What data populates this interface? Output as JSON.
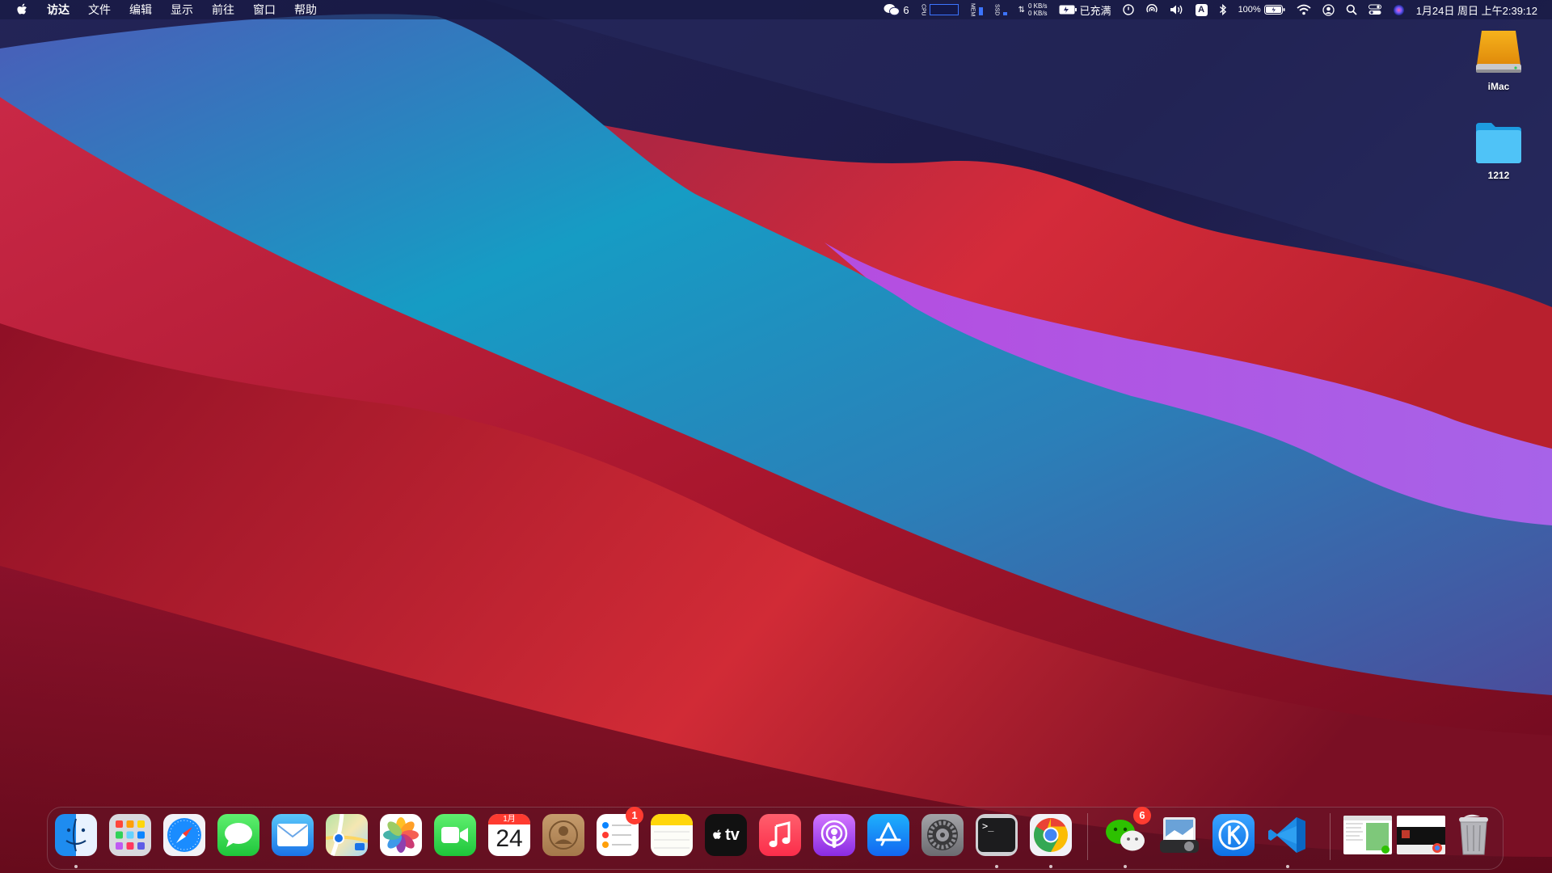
{
  "menubar": {
    "menus": [
      "访达",
      "文件",
      "编辑",
      "显示",
      "前往",
      "窗口",
      "帮助"
    ],
    "status": {
      "wechat_count": "6",
      "net_up": "0 KB/s",
      "net_down": "0 KB/s",
      "battery_state": "已充满",
      "input_source": "A",
      "battery_percent": "100%",
      "datetime": "1月24日 周日 上午2:39:12"
    }
  },
  "desktop": {
    "icons": [
      {
        "label": "iMac",
        "icon": "hard-drive-icon"
      },
      {
        "label": "1212",
        "icon": "folder-icon"
      }
    ]
  },
  "dock": {
    "apps": [
      {
        "name": "finder",
        "running": true
      },
      {
        "name": "launchpad"
      },
      {
        "name": "safari"
      },
      {
        "name": "messages"
      },
      {
        "name": "mail"
      },
      {
        "name": "maps"
      },
      {
        "name": "photos"
      },
      {
        "name": "facetime"
      },
      {
        "name": "calendar",
        "month": "1月",
        "day": "24"
      },
      {
        "name": "contacts"
      },
      {
        "name": "reminders",
        "badge": "1"
      },
      {
        "name": "notes"
      },
      {
        "name": "tv",
        "text": "tv"
      },
      {
        "name": "music"
      },
      {
        "name": "podcasts"
      },
      {
        "name": "app-store"
      },
      {
        "name": "system-preferences"
      },
      {
        "name": "terminal",
        "running": true
      },
      {
        "name": "chrome",
        "running": true
      },
      {
        "name": "wechat",
        "badge": "6",
        "running": true
      },
      {
        "name": "preview"
      },
      {
        "name": "kuaiji"
      },
      {
        "name": "vscode",
        "running": true
      },
      {
        "name": "minimized-window-1"
      },
      {
        "name": "minimized-window-2"
      },
      {
        "name": "trash"
      }
    ]
  },
  "colors": {
    "accent_red": "#d52c3a",
    "accent_teal": "#12a3c7",
    "accent_purple": "#a456e0",
    "sky_navy": "#1c1b48",
    "badge": "#ff3b30"
  }
}
